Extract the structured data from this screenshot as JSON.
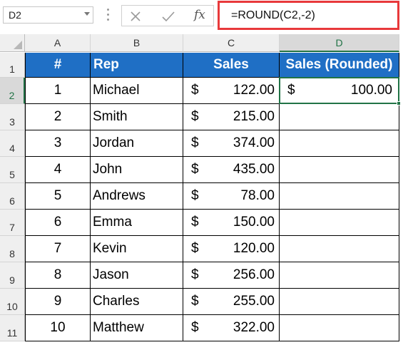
{
  "name_box": {
    "value": "D2"
  },
  "formula_bar": {
    "formula": "=ROUND(C2,-2)",
    "fx_label": "fx"
  },
  "columns": [
    "A",
    "B",
    "C",
    "D"
  ],
  "rows": [
    "1",
    "2",
    "3",
    "4",
    "5",
    "6",
    "7",
    "8",
    "9",
    "10",
    "11"
  ],
  "selected_column": "D",
  "selected_row": "2",
  "header": {
    "num": "#",
    "rep": "Rep",
    "sales": "Sales",
    "rounded": "Sales (Rounded)"
  },
  "currency_symbol": "$",
  "data_rows": [
    {
      "num": "1",
      "rep": "Michael",
      "sales": "122.00",
      "rounded": "100.00"
    },
    {
      "num": "2",
      "rep": "Smith",
      "sales": "215.00",
      "rounded": ""
    },
    {
      "num": "3",
      "rep": "Jordan",
      "sales": "374.00",
      "rounded": ""
    },
    {
      "num": "4",
      "rep": "John",
      "sales": "435.00",
      "rounded": ""
    },
    {
      "num": "5",
      "rep": "Andrews",
      "sales": "78.00",
      "rounded": ""
    },
    {
      "num": "6",
      "rep": "Emma",
      "sales": "150.00",
      "rounded": ""
    },
    {
      "num": "7",
      "rep": "Kevin",
      "sales": "120.00",
      "rounded": ""
    },
    {
      "num": "8",
      "rep": "Jason",
      "sales": "256.00",
      "rounded": ""
    },
    {
      "num": "9",
      "rep": "Charles",
      "sales": "255.00",
      "rounded": ""
    },
    {
      "num": "10",
      "rep": "Matthew",
      "sales": "322.00",
      "rounded": ""
    }
  ],
  "colors": {
    "header_fill": "#1f6fc5",
    "header_text": "#ffffff",
    "selection": "#217346",
    "formula_highlight": "#e8393b"
  }
}
